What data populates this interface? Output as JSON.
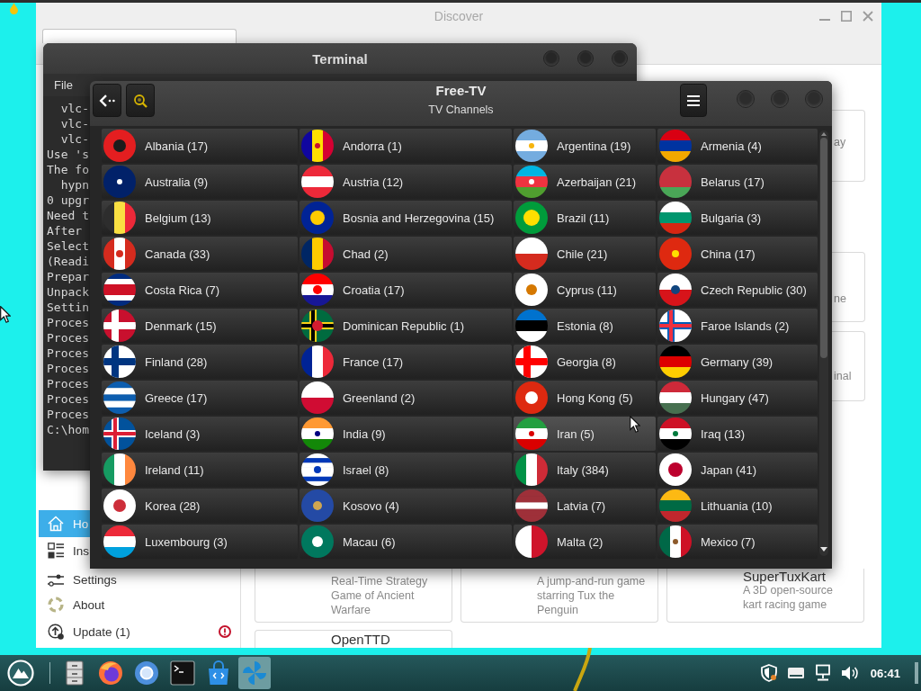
{
  "discover": {
    "title": "Discover",
    "sidebar": {
      "items": [
        {
          "label": "Ho",
          "selected": true,
          "alert": false
        },
        {
          "label": "Ins",
          "selected": false,
          "alert": false
        },
        {
          "label": "Settings",
          "selected": false,
          "alert": false
        },
        {
          "label": "About",
          "selected": false,
          "alert": false
        },
        {
          "label": "Update (1)",
          "selected": false,
          "alert": true
        }
      ]
    },
    "partial_cards": [
      {
        "text": "ay"
      },
      {
        "text": "ne"
      },
      {
        "text": "inal"
      }
    ],
    "cards": [
      {
        "description": "Real-Time Strategy Game of Ancient Warfare"
      },
      {
        "description": "A jump-and-run game starring Tux the Penguin"
      },
      {
        "title": "SuperTuxKart",
        "description": "A 3D open-source kart racing game"
      },
      {
        "title": "OpenTTD"
      }
    ]
  },
  "terminal": {
    "title": "Terminal",
    "menu": [
      "File"
    ],
    "lines": [
      "  vlc-",
      "  vlc-",
      "  vlc-",
      "Use 's",
      "The fo",
      "  hypn",
      "0 upgr",
      "Need t",
      "After",
      "Select",
      "(Readi",
      "Prepar",
      "Unpack",
      "Settin",
      "Proces",
      "Proces",
      "Proces",
      "Proces",
      "Proces",
      "Proces",
      "Proces",
      "C:\\hom"
    ]
  },
  "free_tv": {
    "title": "Free-TV",
    "subtitle": "TV Channels",
    "countries": [
      {
        "label": "Albania (17)",
        "hovered": false
      },
      {
        "label": "Andorra (1)",
        "hovered": false
      },
      {
        "label": "Argentina (19)",
        "hovered": false
      },
      {
        "label": "Armenia (4)",
        "hovered": false
      },
      {
        "label": "Australia (9)",
        "hovered": false
      },
      {
        "label": "Austria (12)",
        "hovered": false
      },
      {
        "label": "Azerbaijan (21)",
        "hovered": false
      },
      {
        "label": "Belarus (17)",
        "hovered": false
      },
      {
        "label": "Belgium (13)",
        "hovered": false
      },
      {
        "label": "Bosnia and Herzegovina (15)",
        "hovered": false
      },
      {
        "label": "Brazil (11)",
        "hovered": false
      },
      {
        "label": "Bulgaria (3)",
        "hovered": false
      },
      {
        "label": "Canada (33)",
        "hovered": false
      },
      {
        "label": "Chad (2)",
        "hovered": false
      },
      {
        "label": "Chile (21)",
        "hovered": false
      },
      {
        "label": "China (17)",
        "hovered": false
      },
      {
        "label": "Costa Rica (7)",
        "hovered": false
      },
      {
        "label": "Croatia (17)",
        "hovered": false
      },
      {
        "label": "Cyprus (11)",
        "hovered": false
      },
      {
        "label": "Czech Republic (30)",
        "hovered": false
      },
      {
        "label": "Denmark (15)",
        "hovered": false
      },
      {
        "label": "Dominican Republic (1)",
        "hovered": false
      },
      {
        "label": "Estonia (8)",
        "hovered": false
      },
      {
        "label": "Faroe Islands (2)",
        "hovered": false
      },
      {
        "label": "Finland (28)",
        "hovered": false
      },
      {
        "label": "France (17)",
        "hovered": false
      },
      {
        "label": "Georgia (8)",
        "hovered": false
      },
      {
        "label": "Germany (39)",
        "hovered": false
      },
      {
        "label": "Greece (17)",
        "hovered": false
      },
      {
        "label": "Greenland (2)",
        "hovered": false
      },
      {
        "label": "Hong Kong (5)",
        "hovered": false
      },
      {
        "label": "Hungary (47)",
        "hovered": false
      },
      {
        "label": "Iceland (3)",
        "hovered": false
      },
      {
        "label": "India (9)",
        "hovered": false
      },
      {
        "label": "Iran (5)",
        "hovered": true
      },
      {
        "label": "Iraq (13)",
        "hovered": false
      },
      {
        "label": "Ireland (11)",
        "hovered": false
      },
      {
        "label": "Israel (8)",
        "hovered": false
      },
      {
        "label": "Italy (384)",
        "hovered": false
      },
      {
        "label": "Japan (41)",
        "hovered": false
      },
      {
        "label": "Korea (28)",
        "hovered": false
      },
      {
        "label": "Kosovo (4)",
        "hovered": false
      },
      {
        "label": "Latvia (7)",
        "hovered": false
      },
      {
        "label": "Lithuania (10)",
        "hovered": false
      },
      {
        "label": "Luxembourg (3)",
        "hovered": false
      },
      {
        "label": "Macau (6)",
        "hovered": false
      },
      {
        "label": "Malta (2)",
        "hovered": false
      },
      {
        "label": "Mexico (7)",
        "hovered": false
      }
    ]
  },
  "taskbar": {
    "launchers": [
      {
        "active": false
      },
      {
        "active": false
      },
      {
        "active": false
      },
      {
        "active": false
      },
      {
        "active": false
      },
      {
        "active": true
      }
    ],
    "clock": "06:41"
  }
}
